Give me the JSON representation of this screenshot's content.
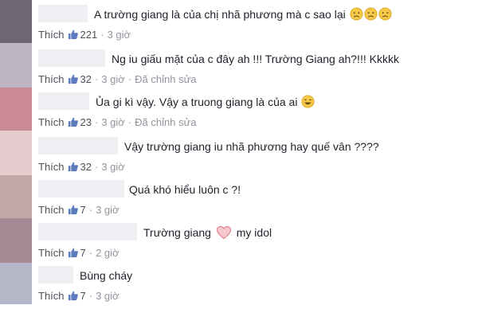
{
  "comments": [
    {
      "text": "A trường giang là của chị nhã phương mà c sao lại",
      "like_label": "Thích",
      "likes": "221",
      "time": "3 giờ",
      "edited": "",
      "emoji": "sad-face",
      "emoji_count": 3,
      "heart": false,
      "avatar_color": "#7a6d7f"
    },
    {
      "text": "Ng iu giấu mặt của c đây ah !!! Trường Giang ah?!!! Kkkkk",
      "like_label": "Thích",
      "likes": "32",
      "time": "3 giờ",
      "edited": "Đã chỉnh sửa",
      "emoji": "",
      "emoji_count": 0,
      "heart": false,
      "avatar_color": "#b9b3bd"
    },
    {
      "text": "Ủa gi kì vậy. Vậy a truong giang là của ai",
      "like_label": "Thích",
      "likes": "23",
      "time": "3 giờ",
      "edited": "Đã chỉnh sửa",
      "emoji": "laughing-face",
      "emoji_count": 1,
      "heart": false,
      "avatar_color": "#c98b94"
    },
    {
      "text": "Vậy trường giang iu nhã phương hay quế vân ????",
      "like_label": "Thích",
      "likes": "32",
      "time": "3 giờ",
      "edited": "",
      "emoji": "",
      "emoji_count": 0,
      "heart": false,
      "avatar_color": "#e3c7cc"
    },
    {
      "text": "Quá khó hiểu luôn c ?!",
      "like_label": "Thích",
      "likes": "7",
      "time": "3 giờ",
      "edited": "",
      "emoji": "",
      "emoji_count": 0,
      "heart": false,
      "avatar_color": "#c2a7a7"
    },
    {
      "text_before": "Trường giang",
      "text_after": "my idol",
      "like_label": "Thích",
      "likes": "7",
      "time": "2 giờ",
      "edited": "",
      "emoji": "",
      "emoji_count": 0,
      "heart": true,
      "avatar_color": "#a58d95"
    },
    {
      "text": "Bùng cháy",
      "like_label": "Thích",
      "likes": "7",
      "time": "3 giờ",
      "edited": "",
      "emoji": "",
      "emoji_count": 0,
      "heart": false,
      "avatar_color": "#b6b8c7"
    }
  ],
  "icons": {
    "like": "thumbs-up-icon",
    "heart": "heart-icon",
    "sad": "sad-face-icon",
    "laugh": "laughing-face-icon"
  },
  "colors": {
    "like_blue": "#5b7bbd",
    "meta_gray": "#90949c",
    "text": "#1d2129"
  }
}
